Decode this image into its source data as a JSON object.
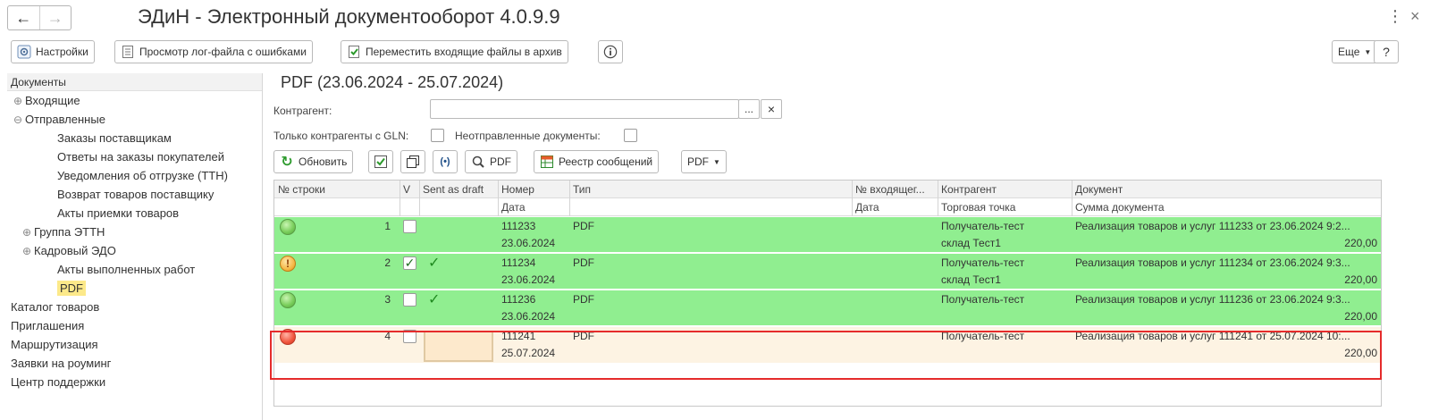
{
  "window": {
    "title": "ЭДиН - Электронный документооборот 4.0.9.9"
  },
  "toolbar": {
    "settings_label": "Настройки",
    "view_log_label": "Просмотр лог-файла с ошибками",
    "move_archive_label": "Переместить входящие файлы в архив",
    "more_label": "Еще",
    "help_label": "?"
  },
  "leftnav": {
    "header": "Документы",
    "items": [
      {
        "label": "Входящие",
        "level": 1,
        "toggle": "⊕"
      },
      {
        "label": "Отправленные",
        "level": 1,
        "toggle": "⊖"
      },
      {
        "label": "Заказы поставщикам",
        "level": 2
      },
      {
        "label": "Ответы на заказы покупателей",
        "level": 2
      },
      {
        "label": "Уведомления об отгрузке (ТТН)",
        "level": 2
      },
      {
        "label": "Возврат товаров поставщику",
        "level": 2
      },
      {
        "label": "Акты приемки товаров",
        "level": 2
      },
      {
        "label": "Группа ЭТТН",
        "level": 1.5,
        "toggle": "⊕"
      },
      {
        "label": "Кадровый ЭДО",
        "level": 1.5,
        "toggle": "⊕"
      },
      {
        "label": "Акты выполненных работ",
        "level": 2
      },
      {
        "label": "PDF",
        "level": 2,
        "selected": true
      },
      {
        "label": "Каталог товаров",
        "level": 0
      },
      {
        "label": "Приглашения",
        "level": 0
      },
      {
        "label": "Маршрутизация",
        "level": 0
      },
      {
        "label": "Заявки на роуминг",
        "level": 0
      },
      {
        "label": "Центр поддержки",
        "level": 0
      }
    ]
  },
  "main": {
    "title": "PDF (23.06.2024 - 25.07.2024)",
    "contractor_label": "Контрагент:",
    "contractor_value": "",
    "select_button": "...",
    "clear_button": "×",
    "gln_only_label": "Только контрагенты с GLN:",
    "unsent_label": "Неотправленные документы:",
    "refresh_label": "Обновить",
    "pdf_preview_label": "PDF",
    "registry_label": "Реестр сообщений",
    "pdf_menu_label": "PDF"
  },
  "grid": {
    "headers_top": {
      "line_no": "№ строки",
      "v": "V",
      "sent_as_draft": "Sent as draft",
      "number": "Номер",
      "type": "Тип",
      "incoming_no": "№ входящег...",
      "contractor": "Контрагент",
      "document": "Документ"
    },
    "headers_bottom": {
      "date": "Дата",
      "incoming_date": "Дата",
      "outlet": "Торговая точка",
      "doc_sum": "Сумма документа"
    },
    "rows": [
      {
        "status": "ok",
        "line": "1",
        "checked": false,
        "draft": false,
        "number": "111233",
        "date": "23.06.2024",
        "type": "PDF",
        "contractor": "Получатель-тест",
        "outlet": "склад Тест1",
        "document": "Реализация товаров и услуг 111233 от 23.06.2024 9:2...",
        "sum": "220,00"
      },
      {
        "status": "warn",
        "line": "2",
        "checked": true,
        "draft": true,
        "number": "111234",
        "date": "23.06.2024",
        "type": "PDF",
        "contractor": "Получатель-тест",
        "outlet": "склад Тест1",
        "document": "Реализация товаров и услуг 111234 от 23.06.2024 9:3...",
        "sum": "220,00"
      },
      {
        "status": "ok",
        "line": "3",
        "checked": false,
        "draft": true,
        "number": "111236",
        "date": "23.06.2024",
        "type": "PDF",
        "contractor": "Получатель-тест",
        "outlet": "",
        "document": "Реализация товаров и услуг 111236 от 23.06.2024 9:3...",
        "sum": "220,00"
      },
      {
        "status": "error",
        "line": "4",
        "checked": false,
        "draft": false,
        "number": "111241",
        "date": "25.07.2024",
        "type": "PDF",
        "contractor": "Получатель-тест",
        "outlet": "",
        "document": "Реализация товаров и услуг 111241 от 25.07.2024 10:...",
        "sum": "220,00"
      }
    ]
  },
  "colors": {
    "row_ok": "#90ee90",
    "row_pending": "#fdf3e3",
    "selected_nav": "#fce98a",
    "highlight_border": "#e52b2b"
  }
}
